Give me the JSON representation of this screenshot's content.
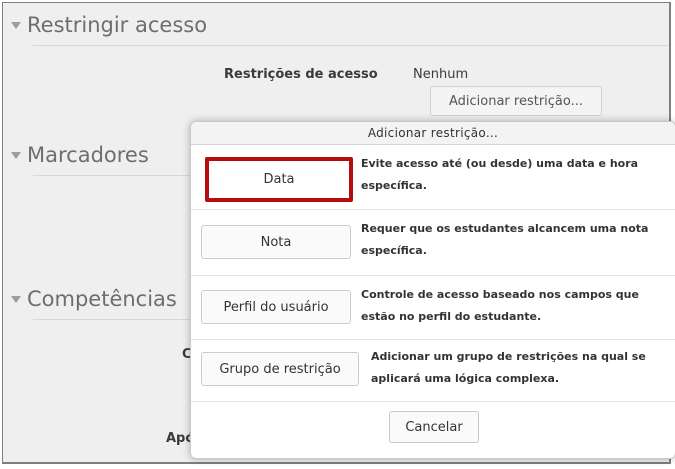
{
  "sections": {
    "restrict": {
      "title": "Restringir acesso"
    },
    "tags": {
      "title": "Marcadores"
    },
    "competencies": {
      "title": "Competências"
    }
  },
  "restrict_panel": {
    "label": "Restrições de acesso",
    "value": "Nenhum",
    "add_button": "Adicionar restrição..."
  },
  "background_fragments": {
    "frag1": "C",
    "frag2": "Apó"
  },
  "dialog": {
    "title": "Adicionar restrição...",
    "options": [
      {
        "label": "Data",
        "line1": "Evite acesso até (ou desde) uma data e hora",
        "line2": "específica."
      },
      {
        "label": "Nota",
        "line1": "Requer que os estudantes alcancem uma nota",
        "line2": "específica."
      },
      {
        "label": "Perfil do usuário",
        "line1": "Controle de acesso baseado nos campos que",
        "line2": "estão no perfil do estudante."
      },
      {
        "label": "Grupo de restrição",
        "line1": "Adicionar um grupo de restrições na qual se",
        "line2": "aplicará uma lógica complexa."
      }
    ],
    "cancel": "Cancelar"
  },
  "colors": {
    "highlight_border": "#b40d0d",
    "page_background": "#efefef"
  }
}
